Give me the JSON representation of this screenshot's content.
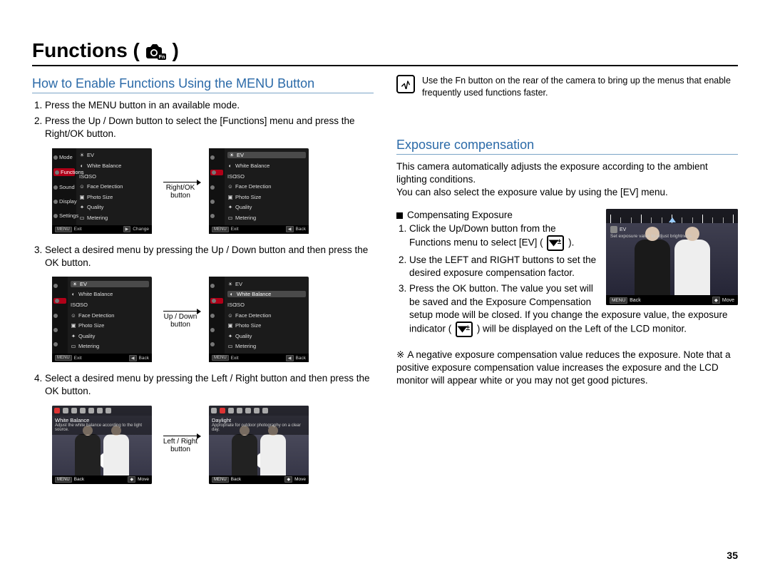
{
  "chapter_title": "Functions (",
  "chapter_title_close": ")",
  "page_number": "35",
  "left": {
    "heading": "How to Enable Functions Using the MENU Button",
    "step1": "Press the MENU button in an available mode.",
    "step2": "Press the Up / Down button to select the [Functions] menu and press the Right/OK button.",
    "arrow1": "Right/OK button",
    "step3": "Select a desired menu by pressing the Up / Down button and then press the OK button.",
    "arrow2": "Up / Down button",
    "step4": "Select a desired menu by pressing the Left / Right button and then press the OK button.",
    "arrow3": "Left / Right button",
    "screenA_left": [
      {
        "label": "Mode"
      },
      {
        "label": "Functions",
        "hl": true
      },
      {
        "label": "Sound"
      },
      {
        "label": "Display"
      },
      {
        "label": "Settings"
      }
    ],
    "screenA_right": [
      {
        "g": "☀",
        "label": "EV"
      },
      {
        "g": "◐",
        "label": "White Balance"
      },
      {
        "g": "ISO",
        "label": "ISO"
      },
      {
        "g": "☺",
        "label": "Face Detection"
      },
      {
        "g": "▣",
        "label": "Photo Size"
      },
      {
        "g": "✦",
        "label": "Quality"
      },
      {
        "g": "▭",
        "label": "Metering"
      }
    ],
    "screenA_foot_l": "Exit",
    "screenA_foot_r": "Change",
    "screenB_right_hl": "EV",
    "screenB_foot_r": "Back",
    "screenC_right_hl": "White Balance",
    "screenD_title": "White Balance",
    "screenD_sub": "Adjust the white balance according to the light source.",
    "screenE_title": "Daylight",
    "screenE_sub": "Appropriate for outdoor photography on a clear day.",
    "foot_back": "Back",
    "foot_move": "Move"
  },
  "right": {
    "fn_note": "Use the Fn button on the rear of the camera to bring up the menus that enable frequently used functions faster.",
    "heading": "Exposure compensation",
    "intro1": "This camera automatically adjusts the exposure according to the ambient lighting conditions.",
    "intro2": "You can also select the exposure value by using the [EV] menu.",
    "sub_heading": "Compensating Exposure",
    "step1a": "Click the Up/Down button from the Functions menu to select [EV] (",
    "step1b": ").",
    "step2": "Use the LEFT and RIGHT buttons to set the desired exposure compensation factor.",
    "step3a": "Press the OK button. The value you set will be saved and the Exposure Compensation setup mode will be closed. If you change the exposure value, the exposure indicator (",
    "step3b": ") will be displayed on the Left of the LCD monitor.",
    "asterisk_note": "A negative exposure compensation value reduces the exposure. Note that a positive exposure compensation value increases the exposure and the LCD monitor will appear white or you may not get good pictures.",
    "ev_label": "EV",
    "ev_sub": "Set exposure value to adjust brightness.",
    "ev_foot_l": "Back",
    "ev_foot_r": "Move"
  }
}
